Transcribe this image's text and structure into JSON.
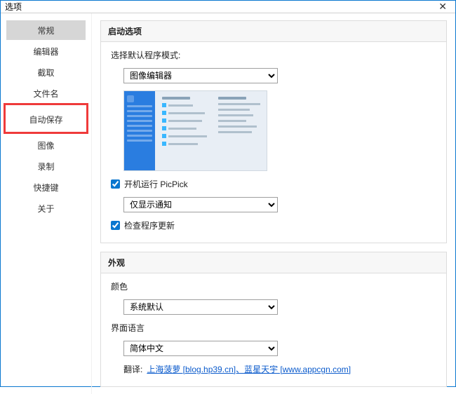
{
  "title": "选项",
  "sidebar": {
    "items": [
      {
        "label": "常规"
      },
      {
        "label": "编辑器"
      },
      {
        "label": "截取"
      },
      {
        "label": "文件名"
      },
      {
        "label": "自动保存"
      },
      {
        "label": "图像"
      },
      {
        "label": "录制"
      },
      {
        "label": "快捷键"
      },
      {
        "label": "关于"
      }
    ]
  },
  "startup": {
    "header": "启动选项",
    "mode_label": "选择默认程序模式:",
    "mode_value": "图像编辑器",
    "run_on_boot": "开机运行 PicPick",
    "notify_value": "仅显示通知",
    "check_update": "检查程序更新"
  },
  "appearance": {
    "header": "外观",
    "color_label": "颜色",
    "color_value": "系统默认",
    "lang_label": "界面语言",
    "lang_value": "简体中文",
    "translate_label": "翻译:",
    "translators": "上海菠萝 [blog.hp39.cn]、蓝星天宇 [www.appcgn.com]"
  }
}
